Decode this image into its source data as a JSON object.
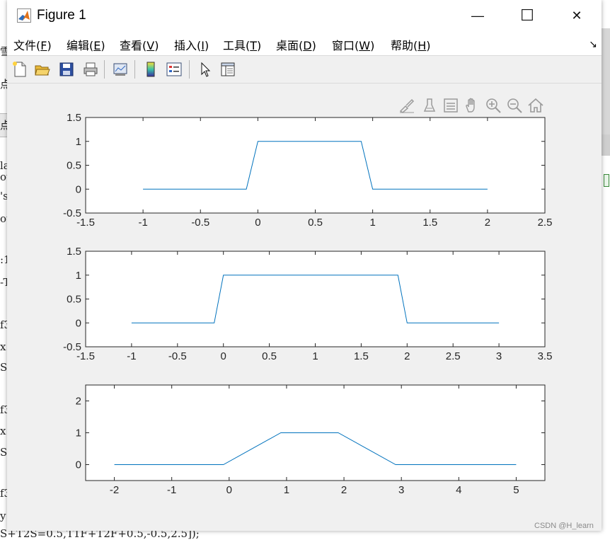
{
  "window": {
    "title": "Figure 1",
    "minimize_glyph": "—",
    "maximize_glyph": "☐",
    "close_glyph": "✕"
  },
  "menu": {
    "items": [
      {
        "label": "文件(",
        "acc": "F",
        "end": ")"
      },
      {
        "label": "编辑(",
        "acc": "E",
        "end": ")"
      },
      {
        "label": "查看(",
        "acc": "V",
        "end": ")"
      },
      {
        "label": "插入(",
        "acc": "I",
        "end": ")"
      },
      {
        "label": "工具(",
        "acc": "T",
        "end": ")"
      },
      {
        "label": "桌面(",
        "acc": "D",
        "end": ")"
      },
      {
        "label": "窗口(",
        "acc": "W",
        "end": ")"
      },
      {
        "label": "帮助(",
        "acc": "H",
        "end": ")"
      }
    ],
    "dock_arrow": "↘"
  },
  "toolbar": {
    "icons": [
      "new-figure-icon",
      "open-file-icon",
      "save-icon",
      "print-icon",
      "link-plot-icon",
      "colorbar-icon",
      "legend-icon",
      "edit-plot-icon",
      "property-inspector-icon"
    ]
  },
  "axes_toolbar": {
    "icons": [
      "brush-icon",
      "data-tips-icon",
      "legend-toggle-icon",
      "pan-icon",
      "zoom-in-icon",
      "zoom-out-icon",
      "home-icon"
    ]
  },
  "background": {
    "lines": [
      {
        "text": "雪",
        "top": 62
      },
      {
        "text": "点",
        "top": 108
      },
      {
        "text": "点",
        "top": 166
      },
      {
        "text": "la",
        "top": 225
      },
      {
        "text": "ou",
        "top": 241
      },
      {
        "text": "'s",
        "top": 268
      },
      {
        "text": "ou",
        "top": 300
      },
      {
        "text": ":1",
        "top": 358
      },
      {
        "text": "-T",
        "top": 390
      },
      {
        "text": "f3",
        "top": 450
      },
      {
        "text": "x",
        "top": 481
      },
      {
        "text": "S",
        "top": 510
      },
      {
        "text": "f3",
        "top": 570
      },
      {
        "text": "x",
        "top": 600
      },
      {
        "text": "S",
        "top": 630
      },
      {
        "text": "f3",
        "top": 688
      },
      {
        "text": "y",
        "top": 720
      },
      {
        "text": "S+T2S=0.5,T1F+T2F+0.5,-0.5,2.5]);",
        "top": 745
      }
    ]
  },
  "watermark": "CSDN @H_learn",
  "chart_data": [
    {
      "type": "line",
      "x": [
        -1,
        -0.1,
        0,
        0.9,
        1,
        2
      ],
      "y": [
        0,
        0,
        1,
        1,
        0,
        0
      ],
      "xlim": [
        -1.5,
        2.5
      ],
      "ylim": [
        -0.5,
        1.5
      ],
      "xticks": [
        -1.5,
        -1,
        -0.5,
        0,
        0.5,
        1,
        1.5,
        2,
        2.5
      ],
      "xtick_labels": [
        "-1.5",
        "-1",
        "-0.5",
        "0",
        "0.5",
        "1",
        "1.5",
        "2",
        "2.5"
      ],
      "yticks": [
        -0.5,
        0,
        0.5,
        1,
        1.5
      ],
      "ytick_labels": [
        "-0.5",
        "0",
        "0.5",
        "1",
        "1.5"
      ],
      "grid": false,
      "color": "#0072bd"
    },
    {
      "type": "line",
      "x": [
        -1,
        -0.1,
        0,
        1.9,
        2,
        3
      ],
      "y": [
        0,
        0,
        1,
        1,
        0,
        0
      ],
      "xlim": [
        -1.5,
        3.5
      ],
      "ylim": [
        -0.5,
        1.5
      ],
      "xticks": [
        -1.5,
        -1,
        -0.5,
        0,
        0.5,
        1,
        1.5,
        2,
        2.5,
        3,
        3.5
      ],
      "xtick_labels": [
        "-1.5",
        "-1",
        "-0.5",
        "0",
        "0.5",
        "1",
        "1.5",
        "2",
        "2.5",
        "3",
        "3.5"
      ],
      "yticks": [
        -0.5,
        0,
        0.5,
        1,
        1.5
      ],
      "ytick_labels": [
        "-0.5",
        "0",
        "0.5",
        "1",
        "1.5"
      ],
      "grid": false,
      "color": "#0072bd"
    },
    {
      "type": "line",
      "x": [
        -2,
        -0.1,
        0.9,
        1.9,
        2.9,
        5
      ],
      "y": [
        0,
        0,
        1,
        1,
        0,
        0
      ],
      "xlim": [
        -2.5,
        5.5
      ],
      "ylim": [
        -0.5,
        2.5
      ],
      "xticks": [
        -2,
        -1,
        0,
        1,
        2,
        3,
        4,
        5
      ],
      "xtick_labels": [
        "-2",
        "-1",
        "0",
        "1",
        "2",
        "3",
        "4",
        "5"
      ],
      "yticks": [
        0,
        1,
        2
      ],
      "ytick_labels": [
        "0",
        "1",
        "2"
      ],
      "grid": false,
      "color": "#0072bd"
    }
  ]
}
